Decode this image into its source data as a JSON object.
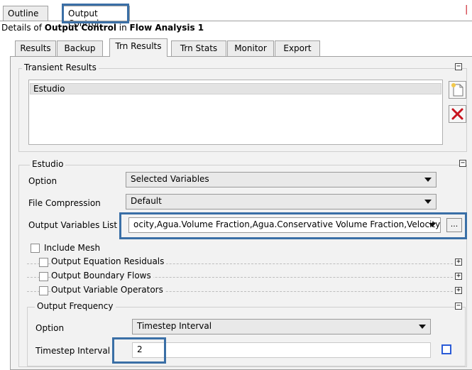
{
  "top_tabs": [
    {
      "label": "Outline",
      "active": false
    },
    {
      "label": "Output Control",
      "active": true
    }
  ],
  "details": {
    "prefix": "Details of ",
    "object": "Output Control",
    "mid": " in ",
    "parent": "Flow Analysis 1"
  },
  "tabs": [
    {
      "label": "Results",
      "active": false
    },
    {
      "label": "Backup",
      "active": false
    },
    {
      "label": "Trn Results",
      "active": true
    },
    {
      "label": "Trn Stats",
      "active": false
    },
    {
      "label": "Monitor",
      "active": false
    },
    {
      "label": "Export",
      "active": false
    }
  ],
  "transient_results": {
    "title": "Transient Results",
    "collapse_icon": "minus-icon",
    "items": [
      "Estudio"
    ],
    "new_icon": "new-document-icon",
    "delete_icon": "red-x-delete-icon"
  },
  "estudio": {
    "title": "Estudio",
    "option_label": "Option",
    "option_value": "Selected Variables",
    "file_compression_label": "File Compression",
    "file_compression_value": "Default",
    "output_vars_label": "Output Variables List",
    "output_vars_value": "ocity,Agua.Volume Fraction,Agua.Conservative Volume Fraction,Velocity",
    "browse_label": "...",
    "include_mesh_label": "Include Mesh",
    "sub_sections": [
      {
        "label": "Output Equation Residuals",
        "expand_icon": "plus-icon"
      },
      {
        "label": "Output Boundary Flows",
        "expand_icon": "plus-icon"
      },
      {
        "label": "Output Variable Operators",
        "expand_icon": "plus-icon"
      }
    ]
  },
  "output_frequency": {
    "title": "Output Frequency",
    "option_label": "Option",
    "option_value": "Timestep Interval",
    "interval_label": "Timestep Interval",
    "interval_value": "2"
  },
  "colors": {
    "highlight": "#3a6fa6",
    "panel_bg": "#f2f2f2",
    "delete_red": "#c8141e"
  }
}
